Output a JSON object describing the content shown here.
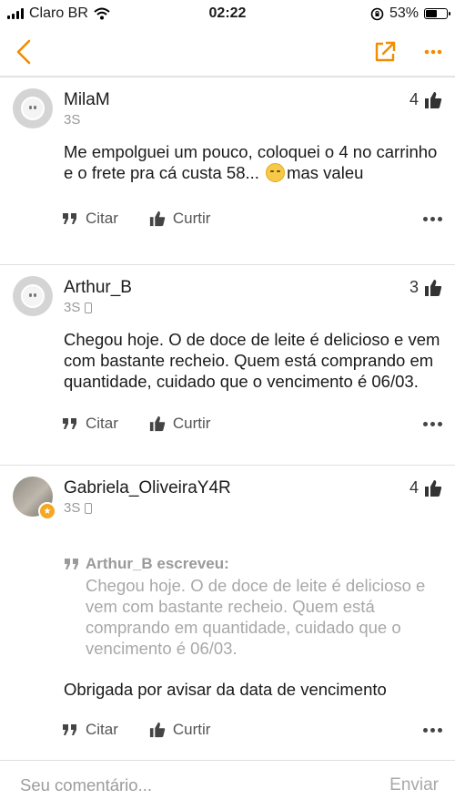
{
  "status": {
    "carrier": "Claro BR",
    "time": "02:22",
    "battery_percent": "53%",
    "battery_level": 0.53
  },
  "nav": {
    "back_icon": "chevron-left-icon",
    "share_icon": "external-link-icon",
    "menu_icon": "ellipsis-icon",
    "accent_color": "#f28c00"
  },
  "comments": [
    {
      "author": "MilaM",
      "time": "3S",
      "likes": "4",
      "text_before_emoji": "Me empolguei um pouco, coloquei o 4 no carrinho e o frete pra cá custa 58... ",
      "text_after_emoji": "mas valeu",
      "emoji": "pensive-face"
    },
    {
      "author": "Arthur_B",
      "time": "3S",
      "likes": "3",
      "text": "Chegou hoje. O de doce de leite é delicioso e vem com bastante recheio. Quem está comprando em quantidade, cuidado que o vencimento é 06/03."
    },
    {
      "author": "Gabriela_OliveiraY4R",
      "time": "3S",
      "likes": "4",
      "quote_author": "Arthur_B escreveu:",
      "quote_text": "Chegou hoje. O de doce de leite é delicioso e vem com bastante recheio. Quem está comprando em quantidade, cuidado que o vencimento é 06/03.",
      "text": "Obrigada por avisar da data de vencimento"
    }
  ],
  "actions": {
    "quote_label": "Citar",
    "like_label": "Curtir"
  },
  "composer": {
    "placeholder": "Seu comentário...",
    "send_label": "Enviar"
  }
}
